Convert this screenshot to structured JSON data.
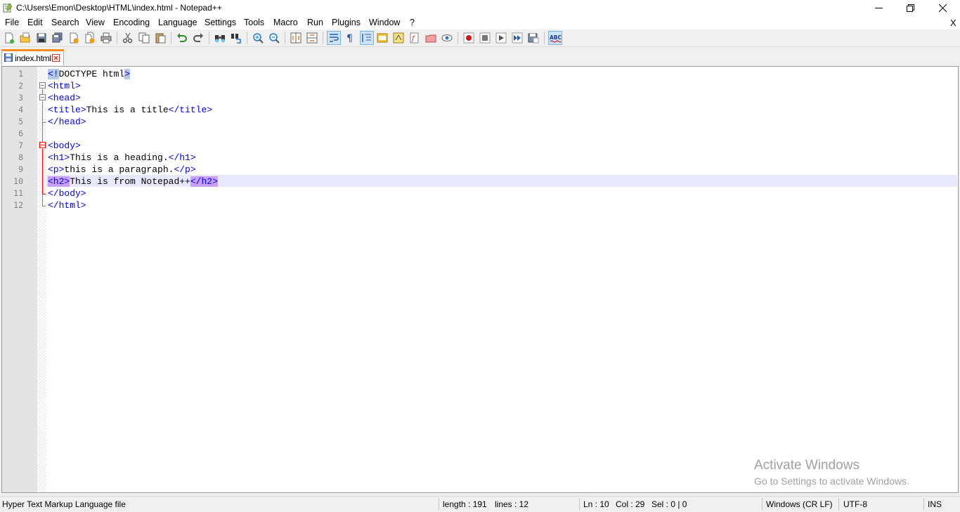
{
  "window": {
    "title": "C:\\Users\\Emon\\Desktop\\HTML\\index.html - Notepad++"
  },
  "menu": {
    "items": [
      "File",
      "Edit",
      "Search",
      "View",
      "Encoding",
      "Language",
      "Settings",
      "Tools",
      "Macro",
      "Run",
      "Plugins",
      "Window",
      "?"
    ],
    "close_doc": "X"
  },
  "toolbar": {
    "icons": [
      "new-file-icon",
      "open-file-icon",
      "save-icon",
      "save-all-icon",
      "close-icon",
      "close-all-icon",
      "print-icon",
      "cut-icon",
      "copy-icon",
      "paste-icon",
      "undo-icon",
      "redo-icon",
      "find-icon",
      "replace-icon",
      "zoom-in-icon",
      "zoom-out-icon",
      "sync-vertical-icon",
      "sync-horizontal-icon",
      "word-wrap-icon",
      "show-all-chars-icon",
      "indent-guide-icon",
      "user-language-icon",
      "doc-map-icon",
      "function-list-icon",
      "folder-workspace-icon",
      "monitoring-icon",
      "record-macro-icon",
      "stop-macro-icon",
      "play-macro-icon",
      "run-macro-multiple-icon",
      "save-macro-icon",
      "spell-check-icon"
    ]
  },
  "tabs": [
    {
      "label": "index.html",
      "active": true
    }
  ],
  "editor": {
    "line_numbers": [
      "1",
      "2",
      "3",
      "4",
      "5",
      "6",
      "7",
      "8",
      "9",
      "10",
      "11",
      "12"
    ],
    "lines": {
      "l1": {
        "t1": "<!",
        "t2": "DOCTYPE html",
        "t3": ">"
      },
      "l2": {
        "t1": "<html>"
      },
      "l3": {
        "t1": "<head>"
      },
      "l4": {
        "t1": "<title>",
        "t2": "This is a title",
        "t3": "</title>"
      },
      "l5": {
        "t1": "</head>"
      },
      "l6": {
        "t1": ""
      },
      "l7": {
        "t1": "<body>"
      },
      "l8": {
        "t1": "<h1>",
        "t2": "This is a heading.",
        "t3": "</h1>"
      },
      "l9": {
        "t1": "<p>",
        "t2": "this is a paragraph.",
        "t3": "</p>"
      },
      "l10": {
        "t1": "<h2>",
        "t2": "This is from Notepad++",
        "t3a": "</",
        "t3b": "h2>"
      },
      "l11": {
        "t1": "</body>"
      },
      "l12": {
        "t1": "</html>"
      }
    },
    "current_line": 10
  },
  "watermark": {
    "line1": "Activate Windows",
    "line2": "Go to Settings to activate Windows."
  },
  "status": {
    "file_type": "Hyper Text Markup Language file",
    "length": "length : 191",
    "lines": "lines : 12",
    "ln": "Ln : 10",
    "col": "Col : 29",
    "sel": "Sel : 0 | 0",
    "eol": "Windows (CR LF)",
    "encoding": "UTF-8",
    "mode": "INS"
  },
  "colors": {
    "tag": "#0000ff",
    "current_line": "#e8e8ff",
    "tab_accent": "#fa8c1e",
    "match_highlight": "#c8a0ff"
  }
}
